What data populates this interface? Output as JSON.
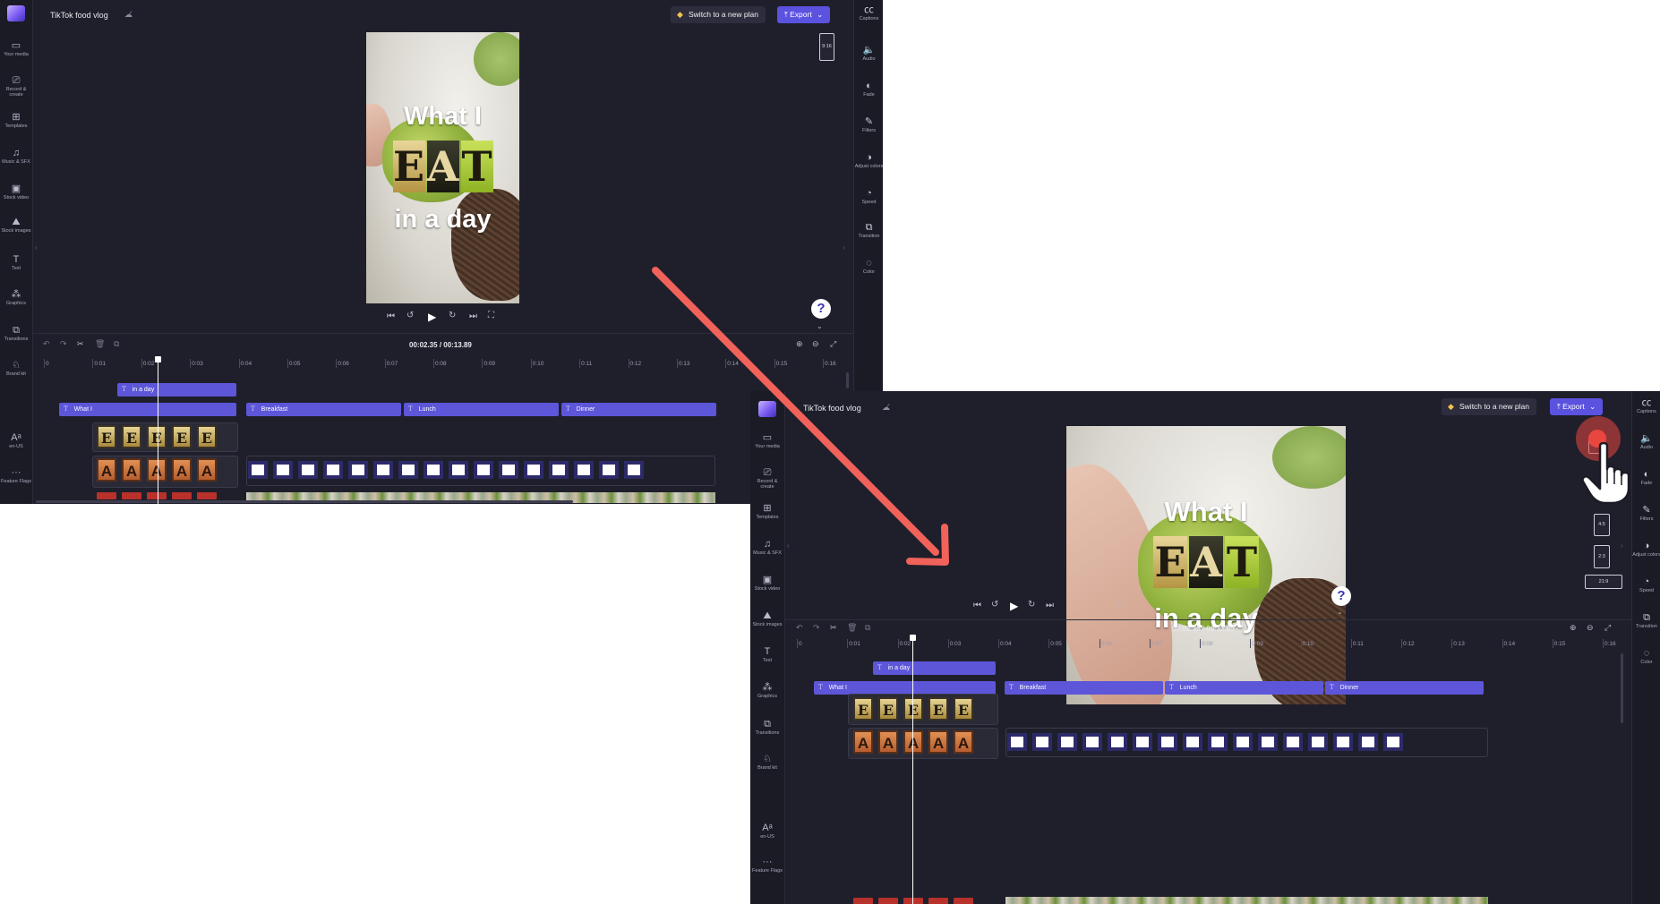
{
  "project": {
    "title": "TikTok food vlog"
  },
  "header": {
    "switch_plan_label": "Switch to a new plan",
    "export_label": "Export",
    "export_chevron": "⌄"
  },
  "left_sidebar": [
    {
      "icon": "folder-icon",
      "glyph": "▭",
      "label": "Your media"
    },
    {
      "icon": "camera-icon",
      "glyph": "⎚",
      "label": "Record & create"
    },
    {
      "icon": "templates-icon",
      "glyph": "⊞",
      "label": "Templates"
    },
    {
      "icon": "music-icon",
      "glyph": "♫",
      "label": "Music & SFX"
    },
    {
      "icon": "stock-video-icon",
      "glyph": "▣",
      "label": "Stock video"
    },
    {
      "icon": "stock-images-icon",
      "glyph": "⛰",
      "label": "Stock images"
    },
    {
      "icon": "text-icon",
      "glyph": "T",
      "label": "Text"
    },
    {
      "icon": "graphics-icon",
      "glyph": "⁂",
      "label": "Graphics"
    },
    {
      "icon": "transitions-icon",
      "glyph": "⧉",
      "label": "Transitions"
    },
    {
      "icon": "brand-kit-icon",
      "glyph": "♘",
      "label": "Brand kit"
    }
  ],
  "left_sidebar_bottom": [
    {
      "icon": "language-icon",
      "glyph": "Aᵃ",
      "label": "en-US"
    },
    {
      "icon": "more-icon",
      "glyph": "···",
      "label": "Feature Flags"
    }
  ],
  "right_sidebar": [
    {
      "icon": "captions-icon",
      "glyph": "㏄",
      "label": "Captions"
    },
    {
      "icon": "audio-icon",
      "glyph": "🔈",
      "label": "Audio"
    },
    {
      "icon": "fade-icon",
      "glyph": "◐",
      "label": "Fade"
    },
    {
      "icon": "filters-icon",
      "glyph": "✎",
      "label": "Filters"
    },
    {
      "icon": "adjust-colors-icon",
      "glyph": "◑",
      "label": "Adjust colors"
    },
    {
      "icon": "speed-icon",
      "glyph": "◔",
      "label": "Speed"
    },
    {
      "icon": "transition-icon",
      "glyph": "⧉",
      "label": "Transition"
    },
    {
      "icon": "color-icon",
      "glyph": "◌",
      "label": "Color"
    }
  ],
  "video_text": {
    "line1": "What I",
    "eat": [
      "E",
      "A",
      "T"
    ],
    "line3": "in a day"
  },
  "aspect_ratios": {
    "current": "9:16",
    "options": [
      "4:5",
      "2:3",
      "21:9"
    ]
  },
  "help": {
    "glyph": "?",
    "chevron": "⌄"
  },
  "playback_controls": {
    "skip_back": "⏮",
    "rewind": "↺",
    "play": "▶",
    "forward": "↻",
    "skip_forward": "⏭",
    "fullscreen": "⛶"
  },
  "timeline_tools": {
    "undo": "↶",
    "redo": "↷",
    "split": "✂",
    "delete": "🗑",
    "duplicate": "⧉",
    "zoom_in": "⊕",
    "zoom_out": "⊖",
    "fit": "⤢"
  },
  "time": {
    "current": "00:02.35",
    "separator": " / ",
    "total": "00:13.89"
  },
  "ruler": [
    "0",
    "0:01",
    "0:02",
    "0:03",
    "0:04",
    "0:05",
    "0:06",
    "0:07",
    "0:08",
    "0:09",
    "0:10",
    "0:11",
    "0:12",
    "0:13",
    "0:14",
    "0:15",
    "0:16"
  ],
  "tracks": {
    "text_top": [
      "in a day"
    ],
    "text_main": [
      "What I",
      "Breakfast",
      "Lunch",
      "Dinner"
    ],
    "t_icon": "T"
  },
  "letter_frames": {
    "e": "E",
    "a": "A"
  },
  "annotation": {
    "arrow_color": "#f0625a",
    "click_color": "#e8463f"
  },
  "colors": {
    "accent": "#5b52e0",
    "panel": "#1f1f2b",
    "clip": "#5d56d9"
  }
}
